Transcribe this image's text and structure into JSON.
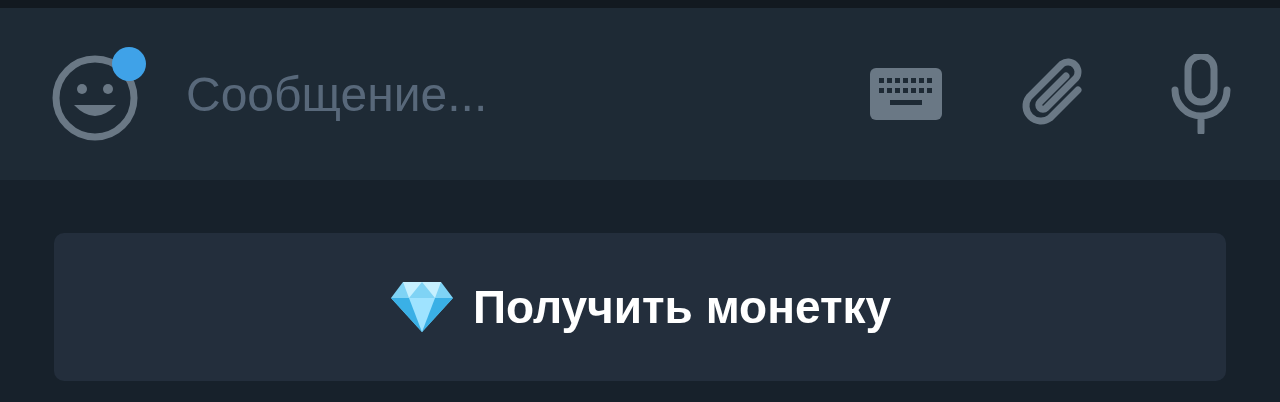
{
  "composer": {
    "placeholder": "Сообщение...",
    "emoji_badge": true
  },
  "action_button": {
    "label": "Получить монетку"
  }
}
